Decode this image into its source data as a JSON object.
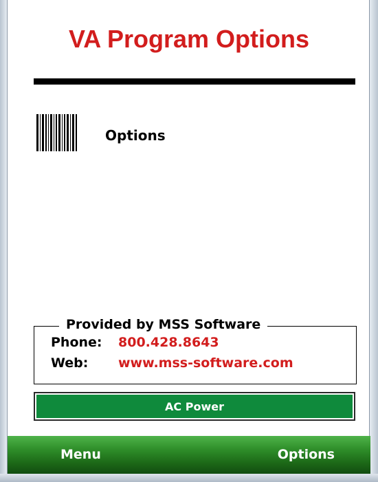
{
  "app": {
    "title": "VA Program Options"
  },
  "options": [
    {
      "icon": "barcode-icon",
      "label": "Options"
    }
  ],
  "provider": {
    "heading": "Provided by MSS Software",
    "phone_label": "Phone:",
    "phone_value": "800.428.8643",
    "web_label": "Web:",
    "web_value": "www.mss-software.com"
  },
  "status": {
    "power_label": "AC Power"
  },
  "softkeys": {
    "left": "Menu",
    "right": "Options"
  },
  "colors": {
    "title": "#d21d1d",
    "power_bar": "#0f8a3c",
    "softbar": "#2f8f2a"
  }
}
